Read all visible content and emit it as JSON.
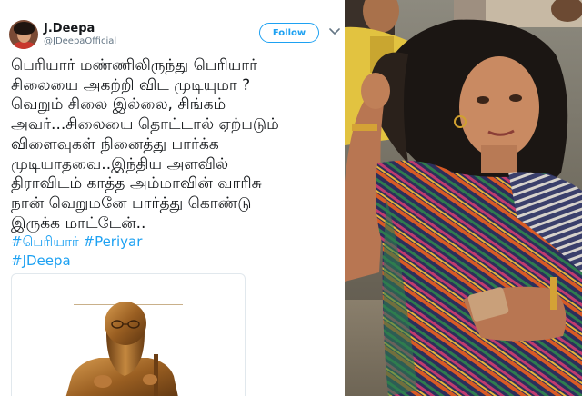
{
  "tweet": {
    "display_name": "J.Deepa",
    "handle": "@JDeepaOfficial",
    "follow_label": "Follow",
    "text_lines": [
      "பெரியார் மண்ணிலிருந்து பெரியார்",
      "சிலையை அகற்றி விட முடியுமா ?",
      "வெறும் சிலை இல்லை, சிங்கம்",
      "அவர்...சிலையை தொட்டால் ஏற்படும்",
      "விளைவுகள் நினைத்து பார்க்க",
      "முடியாதவை..இந்திய அளவில்",
      "திராவிடம் காத்த அம்மாவின் வாரிசு",
      "நான் வெறுமனே பார்த்து கொண்டு",
      "இருக்க மாட்டேன்.."
    ],
    "hashtag_line_1": "#பெரியார் #Periyar",
    "hashtag_line_2": "#JDeepa"
  },
  "colors": {
    "accent": "#1da1f2",
    "text": "#14171a",
    "secondary_text": "#657786"
  },
  "icons": {
    "avatar": "avatar",
    "chevron": "chevron-down-icon",
    "statue": "statue-image",
    "photo": "woman-photo"
  }
}
